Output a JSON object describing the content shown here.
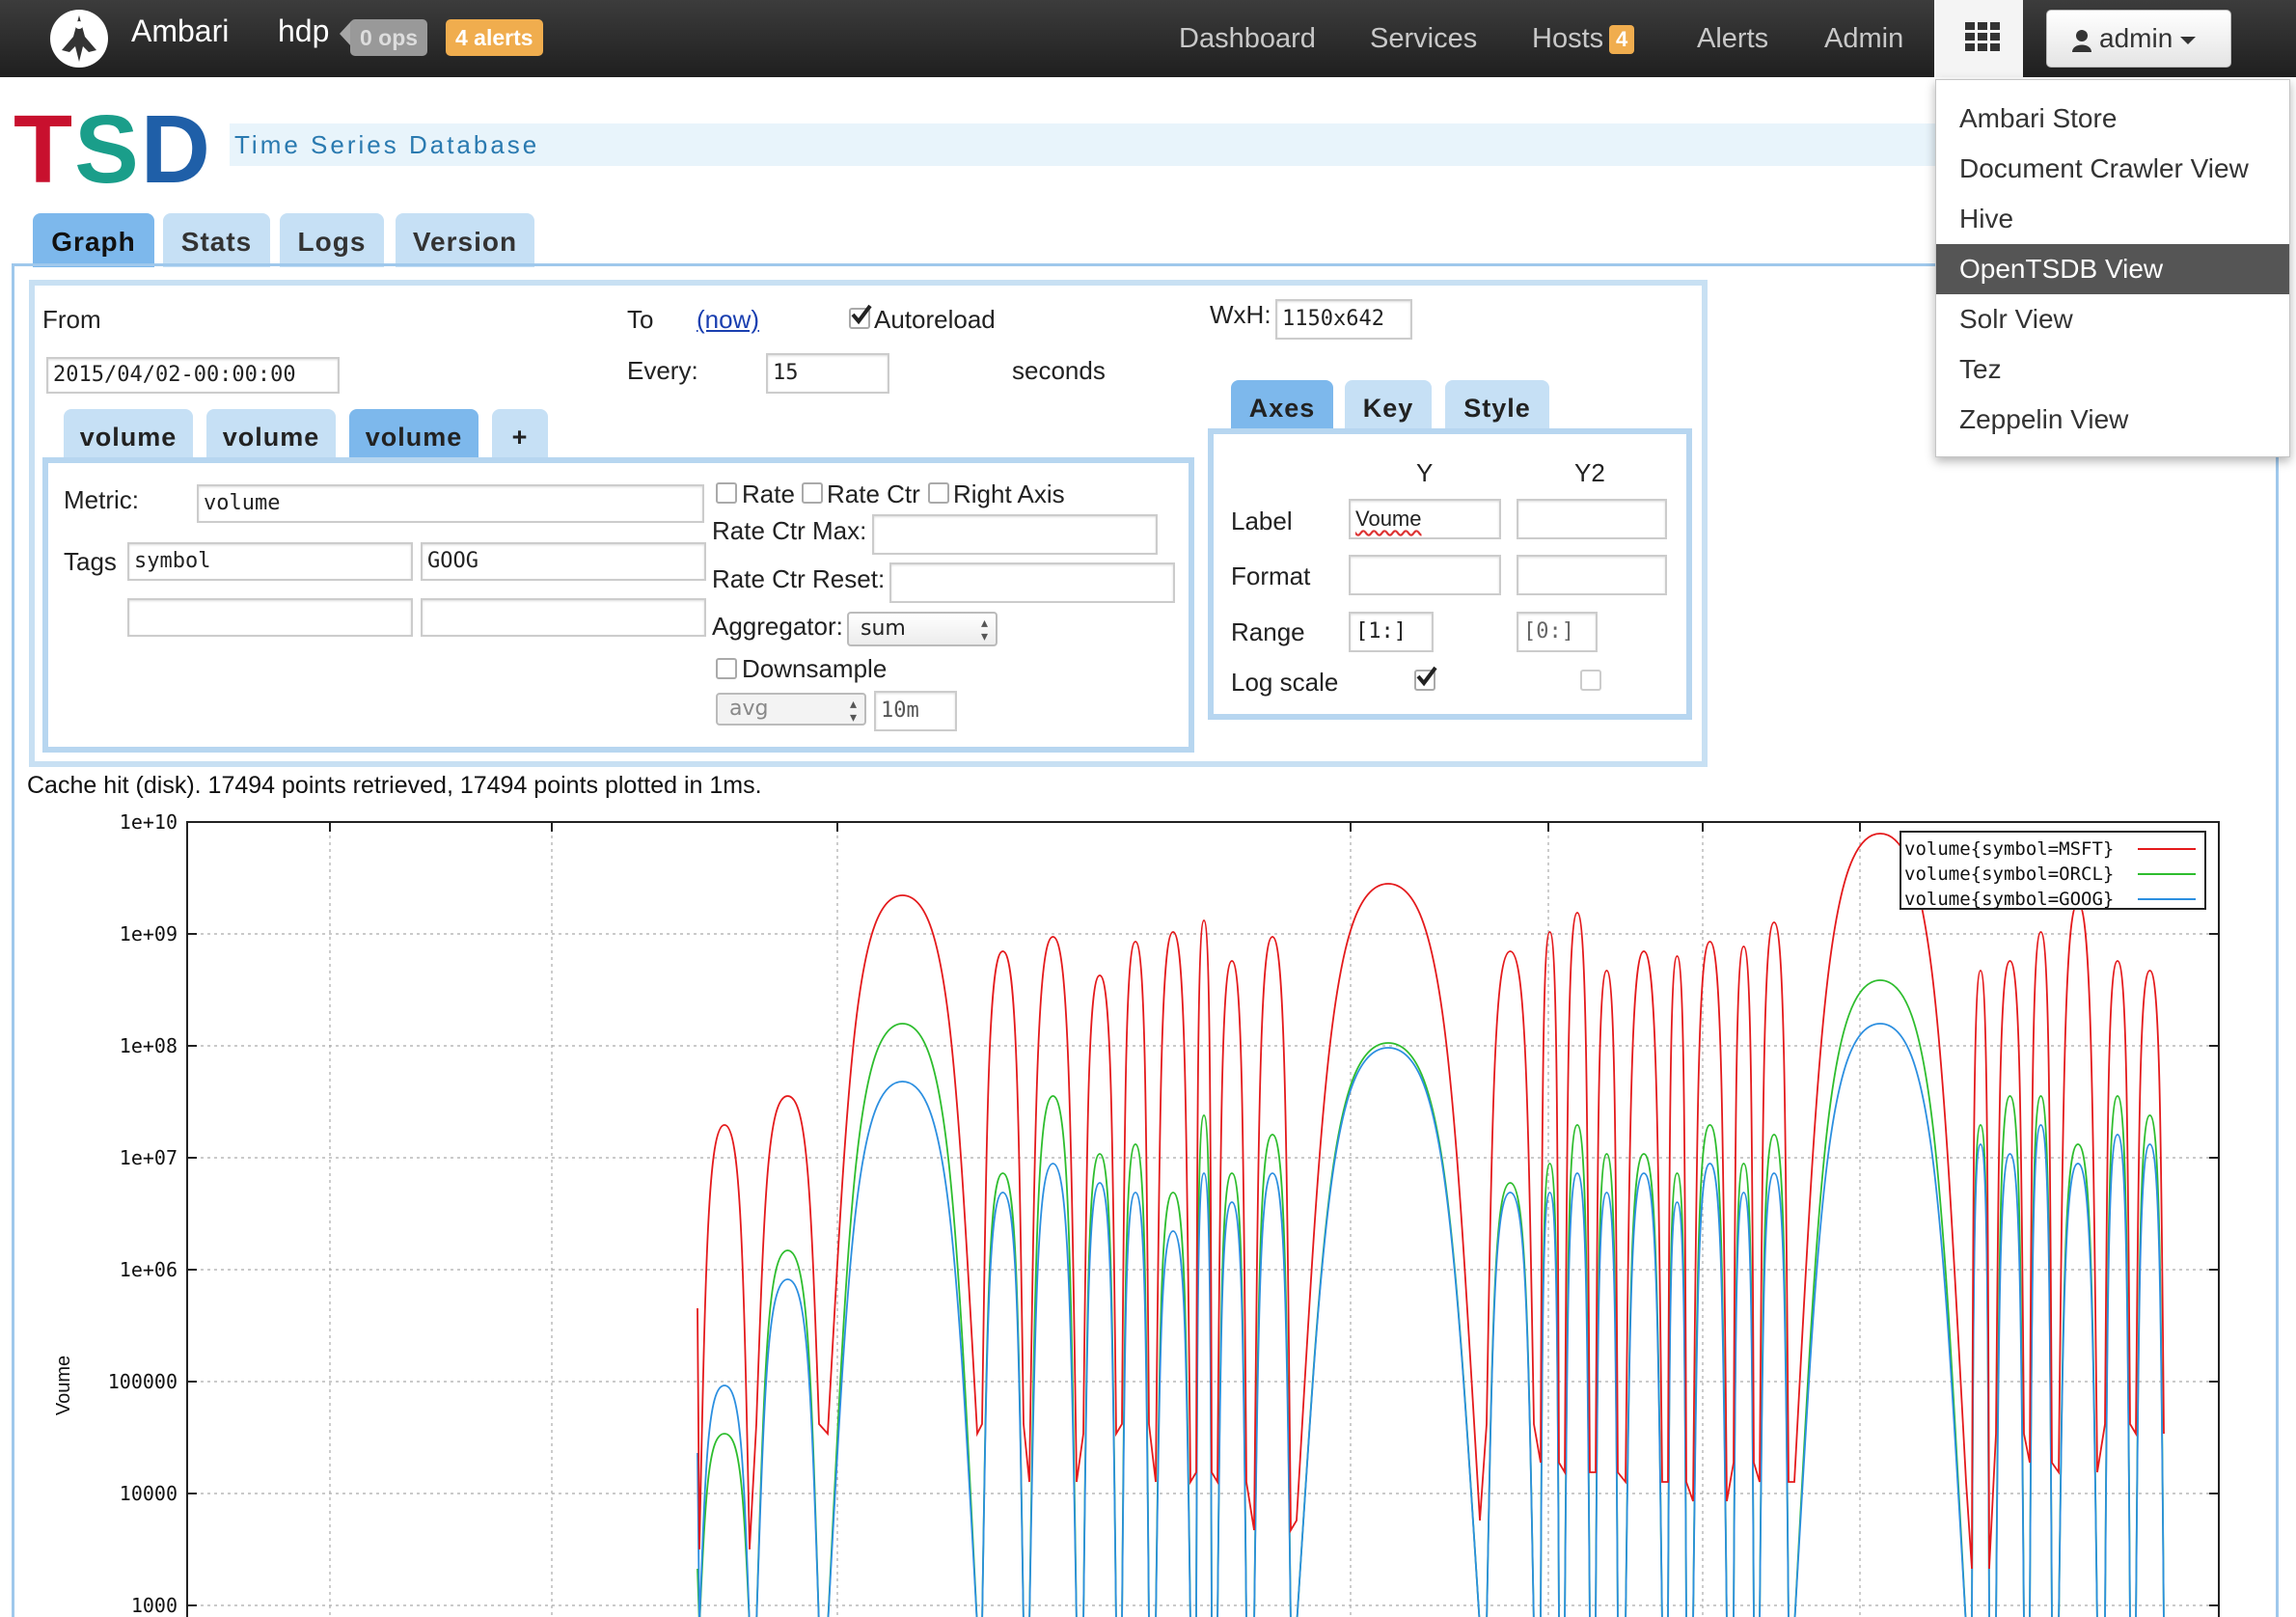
{
  "navbar": {
    "brand": "Ambari",
    "cluster": "hdp",
    "ops_badge": "0 ops",
    "alerts_badge": "4 alerts",
    "links": [
      "Dashboard",
      "Services",
      "Hosts",
      "Alerts",
      "Admin"
    ],
    "hosts_count": "4",
    "user": "admin"
  },
  "views_menu": {
    "items": [
      "Ambari Store",
      "Document Crawler View",
      "Hive",
      "OpenTSDB View",
      "Solr View",
      "Tez",
      "Zeppelin View"
    ],
    "active": "OpenTSDB View"
  },
  "header": {
    "title_t": "T",
    "title_s": "S",
    "title_d": "D",
    "subtitle": "Time Series Database",
    "colors": {
      "t": "#c8102e",
      "s": "#1a9e8a",
      "d": "#1f5fa8"
    }
  },
  "tabs": [
    "Graph",
    "Stats",
    "Logs",
    "Version"
  ],
  "active_tab": "Graph",
  "query": {
    "from_label": "From",
    "from_value": "2015/04/02-00:00:00",
    "to_label": "To",
    "to_link": "(now)",
    "autoreload_label": "Autoreload",
    "autoreload_checked": true,
    "every_label": "Every:",
    "every_value": "15",
    "seconds_label": "seconds",
    "wxh_label": "WxH:",
    "wxh_value": "1150x642",
    "metric_tabs": [
      "volume",
      "volume",
      "volume",
      "+"
    ],
    "active_metric_tab": 2
  },
  "metric": {
    "metric_label": "Metric:",
    "metric_value": "volume",
    "tags_label": "Tags",
    "tag_key": "symbol",
    "tag_value": "GOOG",
    "rate_label": "Rate",
    "rate_ctr_label": "Rate Ctr",
    "right_axis_label": "Right Axis",
    "rate_ctr_max_label": "Rate Ctr Max:",
    "rate_ctr_reset_label": "Rate Ctr Reset:",
    "aggregator_label": "Aggregator:",
    "aggregator_value": "sum",
    "downsample_label": "Downsample",
    "downsample_func": "avg",
    "downsample_interval": "10m"
  },
  "axes": {
    "tabs": [
      "Axes",
      "Key",
      "Style"
    ],
    "active_tab": "Axes",
    "col_y": "Y",
    "col_y2": "Y2",
    "label_label": "Label",
    "y_label_value": "Voume",
    "format_label": "Format",
    "range_label": "Range",
    "y_range": "[1:]",
    "y2_range": "[0:]",
    "logscale_label": "Log scale",
    "y_log_checked": true,
    "y2_log_checked": false
  },
  "status_text": "Cache hit (disk). 17494 points retrieved, 17494 points plotted in 1ms.",
  "chart_data": {
    "type": "line",
    "ylabel": "Voume",
    "yscale": "log",
    "yticks": [
      "1e+10",
      "1e+09",
      "1e+08",
      "1e+07",
      "1e+06",
      "100000",
      "10000",
      "1000"
    ],
    "ylim": [
      1000,
      10000000000
    ],
    "grid": true,
    "legend_position": "top-right",
    "series": [
      {
        "name": "volume{symbol=MSFT}",
        "color": "#e41a1c"
      },
      {
        "name": "volume{symbol=ORCL}",
        "color": "#2ebd2e"
      },
      {
        "name": "volume{symbol=GOOG}",
        "color": "#2c8fe0"
      }
    ]
  }
}
